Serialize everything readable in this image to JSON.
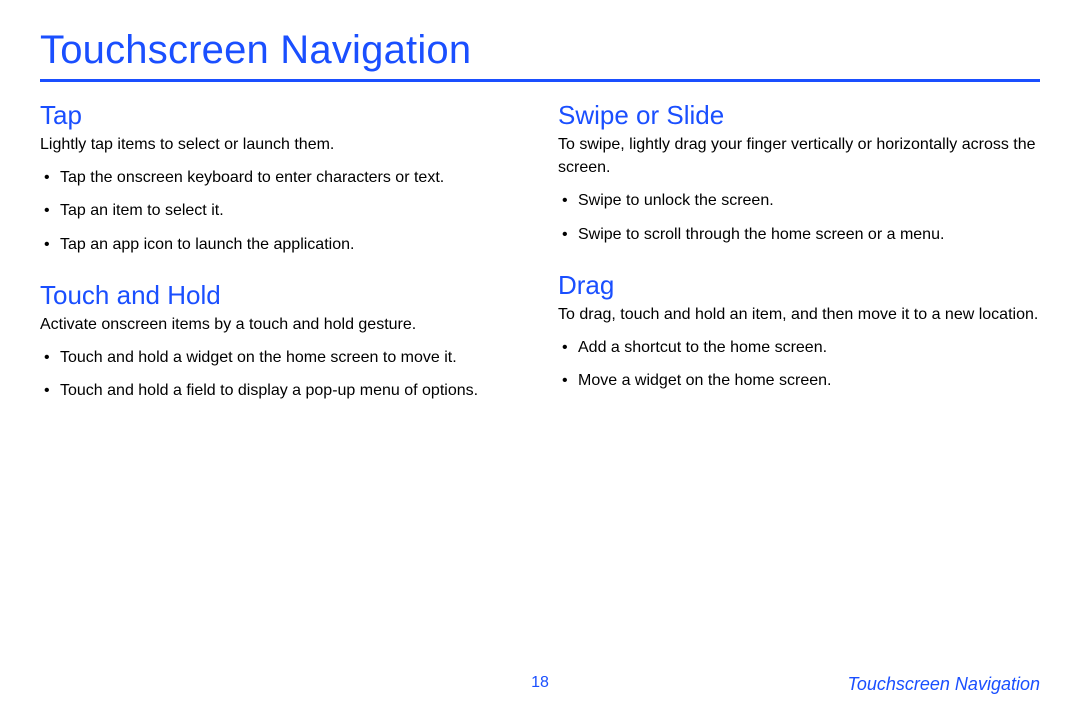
{
  "title": "Touchscreen Navigation",
  "left_column": {
    "sections": [
      {
        "heading": "Tap",
        "intro": "Lightly tap items to select or launch them.",
        "bullets": [
          "Tap the onscreen keyboard to enter characters or text.",
          "Tap an item to select it.",
          "Tap an app icon to launch the application."
        ]
      },
      {
        "heading": "Touch and Hold",
        "intro": "Activate onscreen items by a touch and hold gesture.",
        "bullets": [
          "Touch and hold a widget on the home screen to move it.",
          "Touch and hold a field to display a pop-up menu of options."
        ]
      }
    ]
  },
  "right_column": {
    "sections": [
      {
        "heading": "Swipe or Slide",
        "intro": "To swipe, lightly drag your finger vertically or horizontally across the screen.",
        "bullets": [
          "Swipe to unlock the screen.",
          "Swipe to scroll through the home screen or a menu."
        ]
      },
      {
        "heading": "Drag",
        "intro": "To drag, touch and hold an item, and then move it to a new location.",
        "bullets": [
          "Add a shortcut to the home screen.",
          "Move a widget on the home screen."
        ]
      }
    ]
  },
  "footer": {
    "page_number": "18",
    "section_label": "Touchscreen Navigation"
  }
}
